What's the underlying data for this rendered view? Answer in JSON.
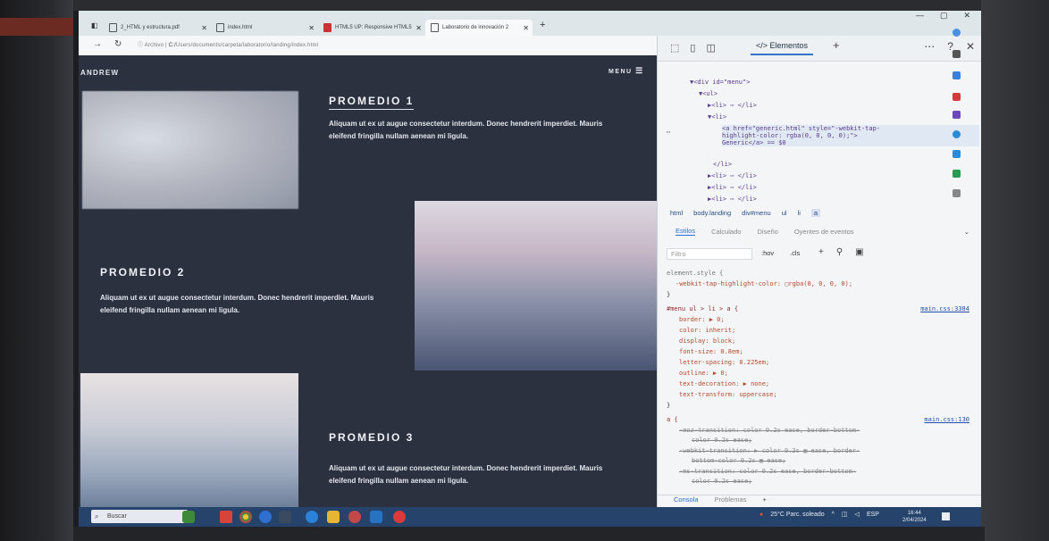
{
  "browser": {
    "tabs": [
      {
        "label": "2_HTML y estructura.pdf",
        "icon": "pdf-icon"
      },
      {
        "label": "index.html",
        "icon": "file-icon"
      },
      {
        "label": "HTML5 UP: Responsive HTML5",
        "icon": "html5-icon"
      },
      {
        "label": "Laboratorio de innovación 2",
        "icon": "file-icon"
      }
    ],
    "new_tab": "+",
    "address": {
      "prefix": "Archivo",
      "host": "C:/",
      "path": "Users/documents/carpeta/laboratorio/landing/index.html"
    },
    "window_controls": [
      "—",
      "▢",
      "✕"
    ]
  },
  "page": {
    "brand": "ANDREW",
    "menu_label": "MENU",
    "sections": [
      {
        "title": "PROMEDIO 1",
        "text": "Aliquam ut ex ut augue consectetur interdum. Donec hendrerit imperdiet. Mauris eleifend fringilla nullam aenean mi ligula."
      },
      {
        "title": "PROMEDIO 2",
        "text": "Aliquam ut ex ut augue consectetur interdum. Donec hendrerit imperdiet. Mauris eleifend fringilla nullam aenean mi ligula."
      },
      {
        "title": "PROMEDIO 3",
        "text": "Aliquam ut ex ut augue consectetur interdum. Donec hendrerit imperdiet. Mauris eleifend fringilla nullam aenean mi ligula."
      }
    ]
  },
  "devtools": {
    "tab_label": "Elementos",
    "tree": {
      "line1": "▼<div id=\"menu\">",
      "line2": "▼<ul>",
      "line3": "▶<li> ⋯ </li>",
      "line4": "▼<li>",
      "line5a": "<a href=\"generic.html\" style=\"-webkit-tap-",
      "line5b": "highlight-color: rgba(0, 0, 0, 0);\">",
      "line5c": "Generic</a> == $0",
      "line6": "</li>",
      "line7": "▶<li> ⋯ </li>",
      "line8": "▶<li> ⋯ </li>",
      "line9": "▶<li> ⋯ </li>"
    },
    "breadcrumbs": [
      "html",
      "body.landing",
      "div#menu",
      "ul",
      "li",
      "a"
    ],
    "subtabs": [
      "Estilos",
      "Calculado",
      "Diseño",
      "Oyentes de eventos"
    ],
    "filter_placeholder": "Filtro",
    "hov": ":hov",
    "cls": ".cls",
    "css": {
      "r1_sel": "element.style {",
      "r1_p1": "-webkit-tap-highlight-color: ▢rgba(0, 0, 0, 0);",
      "r1_end": "}",
      "r2_sel": "#menu ul > li > a {",
      "r2_link": "main.css:3384",
      "r2_p1": "border: ▶ 0;",
      "r2_p2": "color: inherit;",
      "r2_p3": "display: block;",
      "r2_p4": "font-size: 0.8em;",
      "r2_p5": "letter-spacing: 0.225em;",
      "r2_p6": "outline: ▶ 0;",
      "r2_p7": "text-decoration: ▶ none;",
      "r2_p8": "text-transform: uppercase;",
      "r2_end": "}",
      "r3_sel": "a {",
      "r3_link": "main.css:130",
      "r3_p1a": "-moz-transition: color 0.2s ease, border-bottom-",
      "r3_p1b": "color 0.2s ease;",
      "r3_p2a": "-webkit-transition: ▶ color 0.2s ▣ ease, border-",
      "r3_p2b": "bottom-color 0.2s ▣ ease;",
      "r3_p3a": "-ms-transition: color 0.2s ease, border-bottom-",
      "r3_p3b": "color 0.2s ease;"
    },
    "bottom_tabs": [
      "Consola",
      "Problemas",
      "+"
    ]
  },
  "taskbar": {
    "search_label": "Buscar",
    "weather": "25°C  Parc. soleado",
    "lang": "ESP",
    "time": "16:44",
    "date": "2/04/2024"
  },
  "colors": {
    "page_bg": "#2c3140",
    "accent": "#2c6dd1",
    "taskbar": "#25436b"
  }
}
